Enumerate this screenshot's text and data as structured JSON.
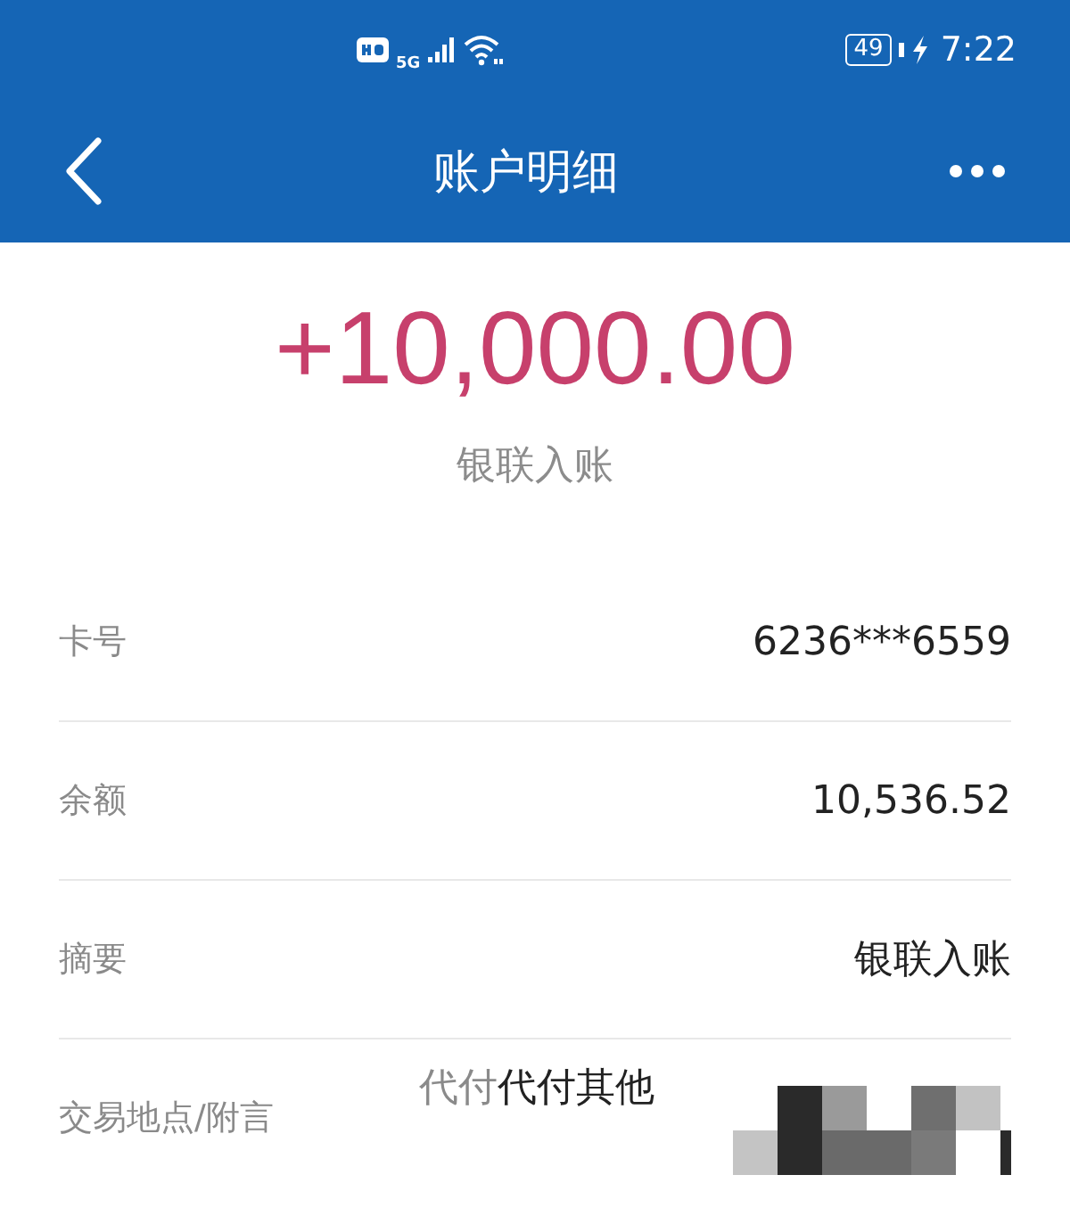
{
  "status_bar": {
    "network": "5G",
    "battery": "49",
    "time": "7:22"
  },
  "header": {
    "title": "账户明细"
  },
  "amount": "+10,000.00",
  "subtitle": "银联入账",
  "details": [
    {
      "label": "卡号",
      "value": "6236***6559"
    },
    {
      "label": "余额",
      "value": "10,536.52"
    },
    {
      "label": "摘要",
      "value": "银联入账"
    },
    {
      "label": "交易地点/附言",
      "value_prefix": "代付",
      "value": "代付其他",
      "redacted": true
    }
  ]
}
